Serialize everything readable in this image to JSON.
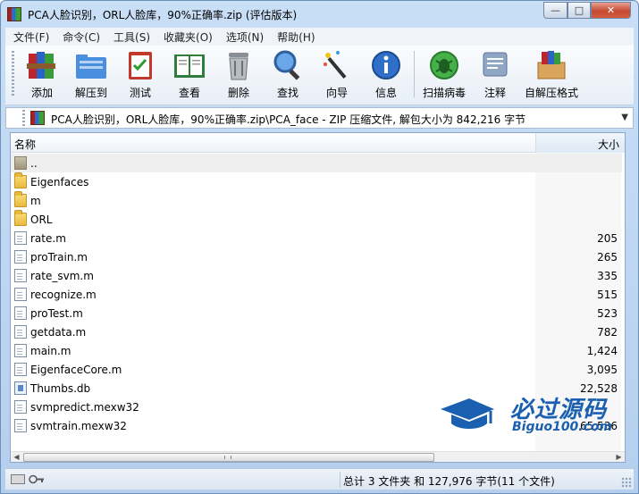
{
  "window": {
    "title": "PCA人脸识别，ORL人脸库，90%正确率.zip (评估版本)",
    "controls": {
      "minimize": "—",
      "maximize": "□",
      "close": "✕"
    }
  },
  "menu": [
    "文件(F)",
    "命令(C)",
    "工具(S)",
    "收藏夹(O)",
    "选项(N)",
    "帮助(H)"
  ],
  "toolbar": [
    {
      "label": "添加",
      "icon": "books-add-icon"
    },
    {
      "label": "解压到",
      "icon": "folder-extract-icon"
    },
    {
      "label": "测试",
      "icon": "clipboard-test-icon"
    },
    {
      "label": "查看",
      "icon": "book-view-icon"
    },
    {
      "label": "删除",
      "icon": "trash-icon"
    },
    {
      "label": "查找",
      "icon": "magnifier-icon"
    },
    {
      "label": "向导",
      "icon": "magic-wand-icon"
    },
    {
      "label": "信息",
      "icon": "info-icon"
    },
    {
      "label": "扫描病毒",
      "icon": "virus-scan-icon"
    },
    {
      "label": "注释",
      "icon": "comment-icon"
    },
    {
      "label": "自解压格式",
      "icon": "sfx-box-icon"
    }
  ],
  "address": {
    "path": "PCA人脸识别，ORL人脸库，90%正确率.zip\\PCA_face - ZIP 压缩文件, 解包大小为 842,216 字节"
  },
  "columns": {
    "name": "名称",
    "size": "大小"
  },
  "files": [
    {
      "name": "..",
      "size": "",
      "type": "up"
    },
    {
      "name": "Eigenfaces",
      "size": "",
      "type": "folder"
    },
    {
      "name": "m",
      "size": "",
      "type": "folder"
    },
    {
      "name": "ORL",
      "size": "",
      "type": "folder"
    },
    {
      "name": "rate.m",
      "size": "205",
      "type": "doc"
    },
    {
      "name": "proTrain.m",
      "size": "265",
      "type": "doc"
    },
    {
      "name": "rate_svm.m",
      "size": "335",
      "type": "doc"
    },
    {
      "name": "recognize.m",
      "size": "515",
      "type": "doc"
    },
    {
      "name": "proTest.m",
      "size": "523",
      "type": "doc"
    },
    {
      "name": "getdata.m",
      "size": "782",
      "type": "doc"
    },
    {
      "name": "main.m",
      "size": "1,424",
      "type": "doc"
    },
    {
      "name": "EigenfaceCore.m",
      "size": "3,095",
      "type": "doc"
    },
    {
      "name": "Thumbs.db",
      "size": "22,528",
      "type": "thumbs"
    },
    {
      "name": "svmpredict.mexw32",
      "size": "",
      "type": "doc"
    },
    {
      "name": "svmtrain.mexw32",
      "size": "65,536",
      "type": "doc"
    }
  ],
  "watermark": {
    "cn": "必过源码",
    "en": "Biguo100.com"
  },
  "status": {
    "text": "总计 3 文件夹 和 127,976 字节(11 个文件)"
  },
  "colors": {
    "accent": "#1a5fb0",
    "close": "#c64a33"
  }
}
